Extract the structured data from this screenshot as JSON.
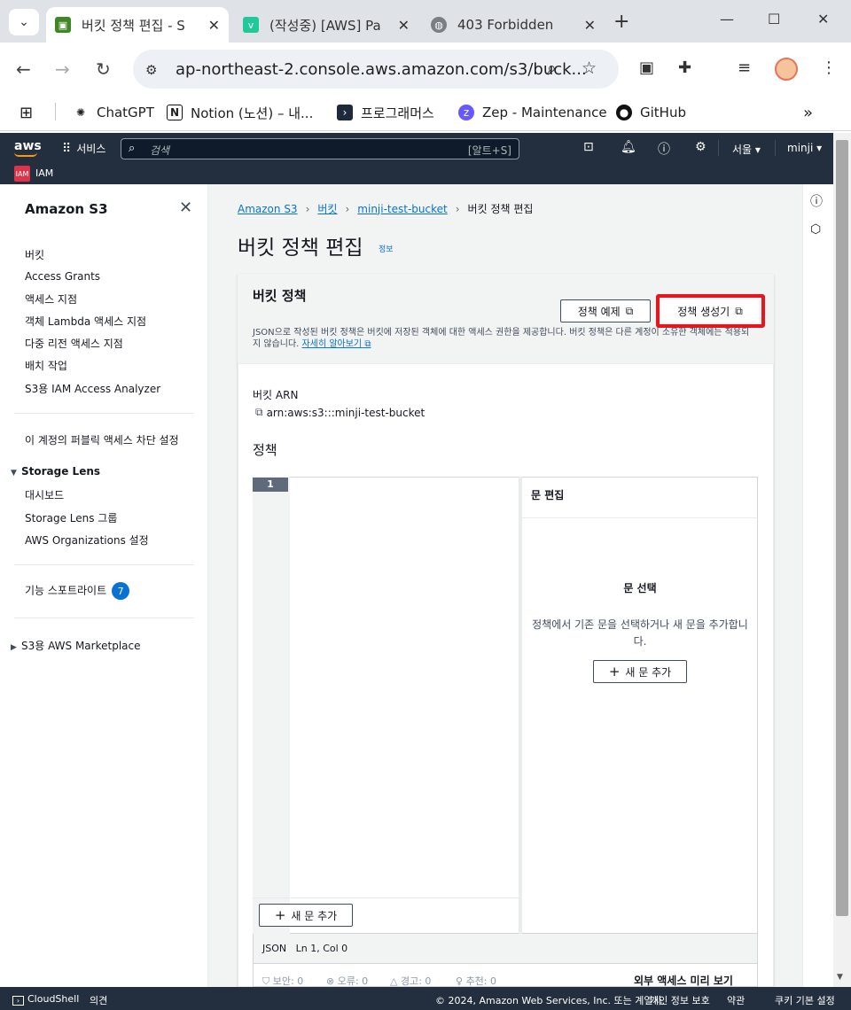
{
  "browser": {
    "tabs": [
      {
        "title": "버킷 정책 편집 - S",
        "active": true
      },
      {
        "title": "(작성중) [AWS] Pa",
        "active": false
      },
      {
        "title": "403 Forbidden",
        "active": false
      }
    ],
    "url": "ap-northeast-2.console.aws.amazon.com/s3/buck...",
    "bookmarks": [
      {
        "label": "ChatGPT"
      },
      {
        "label": "Notion (노션) – 내..."
      },
      {
        "label": "프로그래머스"
      },
      {
        "label": "Zep - Maintenance"
      },
      {
        "label": "GitHub"
      }
    ]
  },
  "aws_nav": {
    "logo": "aws",
    "services": "서비스",
    "search_placeholder": "검색",
    "search_shortcut": "[알트+S]",
    "region": "서울 ▾",
    "user": "minji ▾",
    "pinned_service": "IAM",
    "pinned_badge": "IAM"
  },
  "sidebar": {
    "title": "Amazon S3",
    "items": [
      {
        "label": "버킷"
      },
      {
        "label": "Access Grants"
      },
      {
        "label": "액세스 지점"
      },
      {
        "label": "객체 Lambda 액세스 지점"
      },
      {
        "label": "다중 리전 액세스 지점"
      },
      {
        "label": "배치 작업"
      },
      {
        "label": "S3용 IAM Access Analyzer"
      }
    ],
    "public_block": "이 계정의 퍼블릭 액세스 차단 설정",
    "storage_lens": {
      "label": "Storage Lens",
      "items": [
        {
          "label": "대시보드"
        },
        {
          "label": "Storage Lens 그룹"
        },
        {
          "label": "AWS Organizations 설정"
        }
      ]
    },
    "feature_spotlight": "기능 스포트라이트",
    "feature_badge": "7",
    "marketplace": "S3용 AWS Marketplace"
  },
  "breadcrumb": [
    "Amazon S3",
    "버킷",
    "minji-test-bucket",
    "버킷 정책 편집"
  ],
  "page": {
    "title": "버킷 정책 편집",
    "info": "정보"
  },
  "panel": {
    "title": "버킷 정책",
    "description": "JSON으로 작성된 버킷 정책은 버킷에 저장된 객체에 대한 액세스 권한을 제공합니다. 버킷 정책은 다른 계정이 소유한 객체에는 적용되지 않습니다.",
    "learn_more": "자세히 알아보기",
    "btn_examples": "정책 예제",
    "btn_generator": "정책 생성기",
    "arn_label": "버킷 ARN",
    "arn_value": "arn:aws:s3:::minji-test-bucket",
    "policy_label": "정책"
  },
  "editor": {
    "line_number": "1",
    "add_statement": "새 문 추가",
    "status_lang": "JSON",
    "status_pos": "Ln 1, Col 0",
    "right_title": "문 편집",
    "select_title": "문 선택",
    "select_desc": "정책에서 기존 문을 선택하거나 새 문을 추가합니다.",
    "right_add": "새 문 추가",
    "lint": {
      "security": "보안: 0",
      "errors": "오류: 0",
      "warnings": "경고: 0",
      "suggestions": "추천: 0",
      "preview": "외부 액세스 미리 보기"
    }
  },
  "footer": {
    "cloudshell": "CloudShell",
    "feedback": "의견",
    "copyright": "© 2024, Amazon Web Services, Inc. 또는 계열사.",
    "privacy": "개인 정보 보호",
    "terms": "약관",
    "cookies": "쿠키 기본 설정"
  },
  "colors": {
    "aws_nav": "#232f3e",
    "link": "#0972d3",
    "highlight": "#e8141e",
    "aws_orange": "#ff9900"
  }
}
